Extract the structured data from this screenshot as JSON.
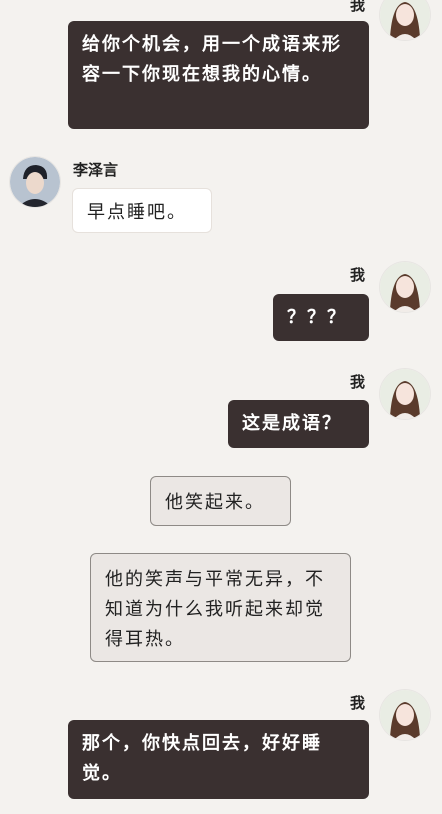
{
  "messages": [
    {
      "sender": "我",
      "text": "给你个机会，用一个成语来形容一下你现在想我的心情。"
    },
    {
      "sender": "李泽言",
      "text": "早点睡吧。"
    },
    {
      "sender": "我",
      "text": "？？？"
    },
    {
      "sender": "我",
      "text": "这是成语？"
    },
    {
      "type": "narration",
      "text": "他笑起来。"
    },
    {
      "type": "narration",
      "text": "他的笑声与平常无异，不知道为什么我听起来却觉得耳热。"
    },
    {
      "sender": "我",
      "text": "那个，你快点回去，好好睡觉。"
    }
  ],
  "colors": {
    "background": "#f4f2ef",
    "my_bubble": "#3a3030",
    "other_bubble": "#ffffff",
    "narration_bubble": "#ebe7e4"
  }
}
